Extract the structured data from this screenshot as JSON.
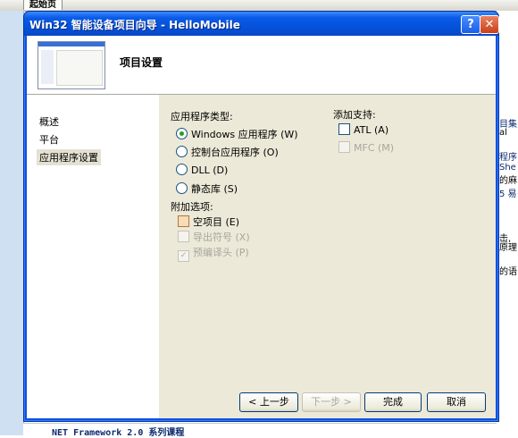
{
  "background": {
    "tab_label": "起始页",
    "right_fragments": [
      "目集;",
      "al",
      "程序",
      "She",
      "的麻",
      "5 易",
      "击,",
      "原理",
      "的语"
    ],
    "bottom_link": "NET Framework 2.0 系列课程"
  },
  "dialog": {
    "title": "Win32 智能设备项目向导 - HelloMobile",
    "help_glyph": "?",
    "close_glyph": "✕",
    "page_title": "项目设置",
    "nav": [
      {
        "label": "概述"
      },
      {
        "label": "平台"
      },
      {
        "label": "应用程序设置",
        "selected": true
      }
    ],
    "app_type": {
      "label": "应用程序类型:",
      "options": [
        {
          "label": "Windows 应用程序 (W)",
          "checked": true
        },
        {
          "label": "控制台应用程序 (O)",
          "checked": false
        },
        {
          "label": "DLL (D)",
          "checked": false
        },
        {
          "label": "静态库 (S)",
          "checked": false
        }
      ]
    },
    "additional": {
      "label": "附加选项:",
      "options": [
        {
          "label": "空项目 (E)",
          "checked": false,
          "enabled": true
        },
        {
          "label": "导出符号 (X)",
          "checked": false,
          "enabled": false
        },
        {
          "label": "预编译头 (P)",
          "checked": true,
          "enabled": false
        }
      ]
    },
    "support": {
      "label": "添加支持:",
      "options": [
        {
          "label": "ATL (A)",
          "checked": false,
          "enabled": true
        },
        {
          "label": "MFC (M)",
          "checked": false,
          "enabled": false
        }
      ]
    },
    "buttons": {
      "back": "< 上一步",
      "next": "下一步 >",
      "finish": "完成",
      "cancel": "取消"
    }
  }
}
